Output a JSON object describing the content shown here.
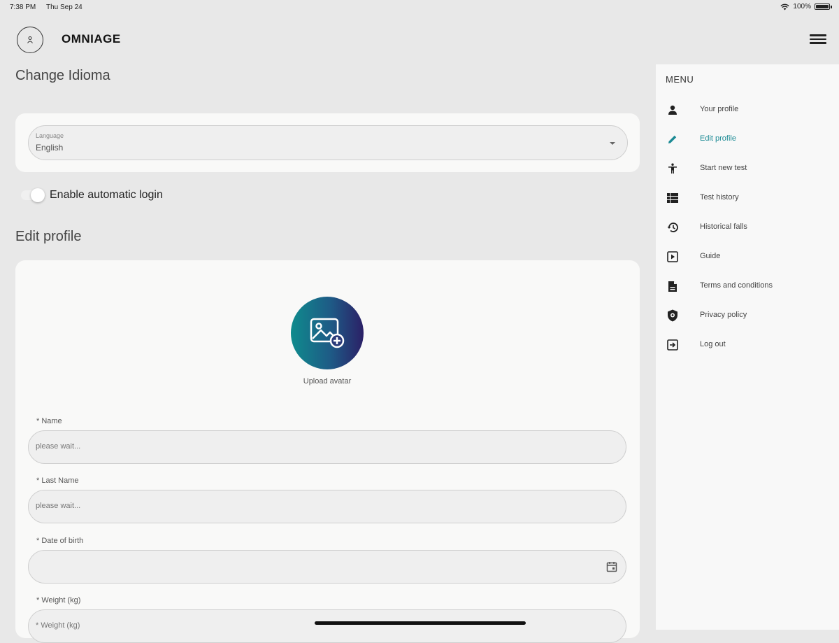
{
  "status_bar": {
    "time": "7:38 PM",
    "date": "Thu Sep 24",
    "battery": "100%"
  },
  "header": {
    "app_title": "OMNIAGE"
  },
  "language_section": {
    "title": "Change Idioma",
    "field_label": "Language",
    "field_value": "English"
  },
  "auto_login": {
    "label": "Enable automatic login",
    "enabled": false
  },
  "edit_profile": {
    "title": "Edit profile",
    "upload_label": "Upload avatar",
    "fields": [
      {
        "label": "* Name",
        "placeholder": "please wait..."
      },
      {
        "label": "* Last Name",
        "placeholder": "please wait..."
      },
      {
        "label": "* Date of birth",
        "placeholder": ""
      },
      {
        "label": "* Weight (kg)",
        "placeholder": "* Weight (kg)"
      }
    ]
  },
  "menu": {
    "heading": "MENU",
    "items": [
      {
        "label": "Your profile",
        "icon": "person-icon"
      },
      {
        "label": "Edit profile",
        "icon": "pencil-icon",
        "active": true
      },
      {
        "label": "Start new test",
        "icon": "figure-icon"
      },
      {
        "label": "Test history",
        "icon": "list-icon"
      },
      {
        "label": "Historical falls",
        "icon": "history-icon"
      },
      {
        "label": "Guide",
        "icon": "play-box-icon"
      },
      {
        "label": "Terms and conditions",
        "icon": "document-icon"
      },
      {
        "label": "Privacy policy",
        "icon": "shield-icon"
      },
      {
        "label": "Log out",
        "icon": "logout-icon"
      }
    ],
    "active_color": "#1b8a94"
  }
}
